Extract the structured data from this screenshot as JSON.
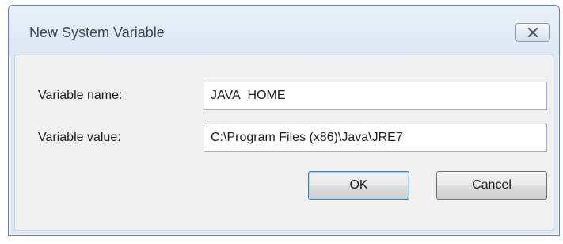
{
  "dialog": {
    "title": "New System Variable",
    "close_icon": "close-icon"
  },
  "form": {
    "name_label": "Variable name:",
    "name_value": "JAVA_HOME",
    "value_label": "Variable value:",
    "value_value": "C:\\Program Files (x86)\\Java\\JRE7"
  },
  "buttons": {
    "ok_label": "OK",
    "cancel_label": "Cancel"
  },
  "colors": {
    "frame": "#dde8f4",
    "client": "#f0f0f0",
    "ok_focus_border": "#3c7fb1"
  }
}
